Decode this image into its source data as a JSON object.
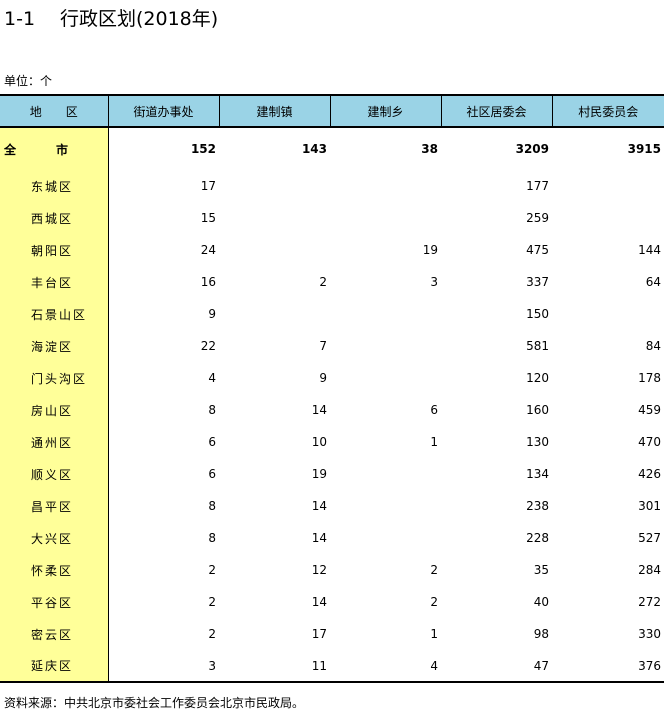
{
  "title": {
    "number": "1-1",
    "text": "行政区划(2018年)"
  },
  "unit": "单位：个",
  "table": {
    "headers": [
      "地　　区",
      "街道办事处",
      "建制镇",
      "建制乡",
      "社区居委会",
      "村民委员会"
    ],
    "total": {
      "label_a": "全",
      "label_b": "市",
      "values": [
        "152",
        "143",
        "38",
        "3209",
        "3915"
      ]
    },
    "rows": [
      {
        "area": "东城区",
        "values": [
          "17",
          "",
          "",
          "177",
          ""
        ]
      },
      {
        "area": "西城区",
        "values": [
          "15",
          "",
          "",
          "259",
          ""
        ]
      },
      {
        "area": "朝阳区",
        "values": [
          "24",
          "",
          "19",
          "475",
          "144"
        ]
      },
      {
        "area": "丰台区",
        "values": [
          "16",
          "2",
          "3",
          "337",
          "64"
        ]
      },
      {
        "area": "石景山区",
        "values": [
          "9",
          "",
          "",
          "150",
          ""
        ]
      },
      {
        "area": "海淀区",
        "values": [
          "22",
          "7",
          "",
          "581",
          "84"
        ]
      },
      {
        "area": "门头沟区",
        "values": [
          "4",
          "9",
          "",
          "120",
          "178"
        ]
      },
      {
        "area": "房山区",
        "values": [
          "8",
          "14",
          "6",
          "160",
          "459"
        ]
      },
      {
        "area": "通州区",
        "values": [
          "6",
          "10",
          "1",
          "130",
          "470"
        ]
      },
      {
        "area": "顺义区",
        "values": [
          "6",
          "19",
          "",
          "134",
          "426"
        ]
      },
      {
        "area": "昌平区",
        "values": [
          "8",
          "14",
          "",
          "238",
          "301"
        ]
      },
      {
        "area": "大兴区",
        "values": [
          "8",
          "14",
          "",
          "228",
          "527"
        ]
      },
      {
        "area": "怀柔区",
        "values": [
          "2",
          "12",
          "2",
          "35",
          "284"
        ]
      },
      {
        "area": "平谷区",
        "values": [
          "2",
          "14",
          "2",
          "40",
          "272"
        ]
      },
      {
        "area": "密云区",
        "values": [
          "2",
          "17",
          "1",
          "98",
          "330"
        ]
      },
      {
        "area": "延庆区",
        "values": [
          "3",
          "11",
          "4",
          "47",
          "376"
        ]
      }
    ]
  },
  "source": "资料来源：中共北京市委社会工作委员会北京市民政局。"
}
